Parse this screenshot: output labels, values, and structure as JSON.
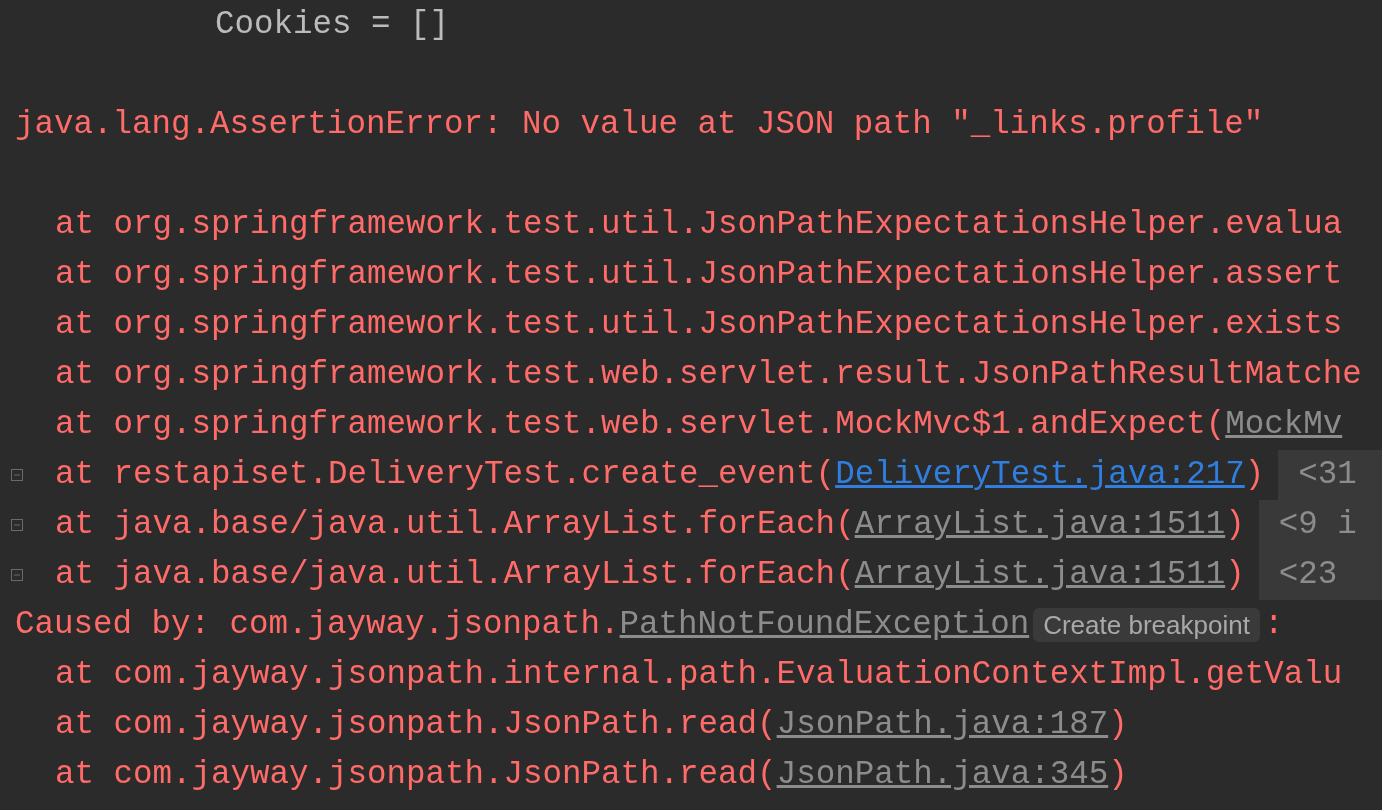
{
  "console": {
    "lines": [
      {
        "kind": "plain",
        "text": "Cookies = []"
      },
      {
        "kind": "blank"
      },
      {
        "kind": "error",
        "text": "java.lang.AssertionError: No value at JSON path \"_links.profile\""
      },
      {
        "kind": "blank"
      },
      {
        "kind": "frame",
        "foldable": false,
        "text": "at org.springframework.test.util.JsonPathExpectationsHelper.evalua"
      },
      {
        "kind": "frame",
        "foldable": false,
        "text": "at org.springframework.test.util.JsonPathExpectationsHelper.assert"
      },
      {
        "kind": "frame",
        "foldable": false,
        "text": "at org.springframework.test.util.JsonPathExpectationsHelper.exists"
      },
      {
        "kind": "frame",
        "foldable": false,
        "text": "at org.springframework.test.web.servlet.result.JsonPathResultMatche"
      },
      {
        "kind": "frame",
        "foldable": false,
        "text": "at org.springframework.test.web.servlet.MockMvc$1.andExpect(",
        "link": "MockMv",
        "project_link": false
      },
      {
        "kind": "frame",
        "foldable": true,
        "text": "at restapiset.DeliveryTest.create_event(",
        "link": "DeliveryTest.java:217",
        "project_link": true,
        "close": ")",
        "badge": "<31"
      },
      {
        "kind": "frame",
        "foldable": true,
        "text": "at java.base/java.util.ArrayList.forEach(",
        "link": "ArrayList.java:1511",
        "project_link": false,
        "close": ")",
        "badge": "<9 i"
      },
      {
        "kind": "frame",
        "foldable": true,
        "text": "at java.base/java.util.ArrayList.forEach(",
        "link": "ArrayList.java:1511",
        "project_link": false,
        "close": ")",
        "badge": "<23"
      },
      {
        "kind": "caused",
        "text": "Caused by: com.jayway.jsonpath.",
        "link": "PathNotFoundException",
        "project_link": false,
        "tooltip": "Create breakpoint",
        "close": ":"
      },
      {
        "kind": "frame",
        "foldable": false,
        "text": "at com.jayway.jsonpath.internal.path.EvaluationContextImpl.getValu"
      },
      {
        "kind": "frame",
        "foldable": false,
        "text": "at com.jayway.jsonpath.JsonPath.read(",
        "link": "JsonPath.java:187",
        "project_link": false,
        "close": ")"
      },
      {
        "kind": "frame",
        "foldable": false,
        "text": "at com.jayway.jsonpath.JsonPath.read(",
        "link": "JsonPath.java:345",
        "project_link": false,
        "close": ")"
      }
    ]
  }
}
